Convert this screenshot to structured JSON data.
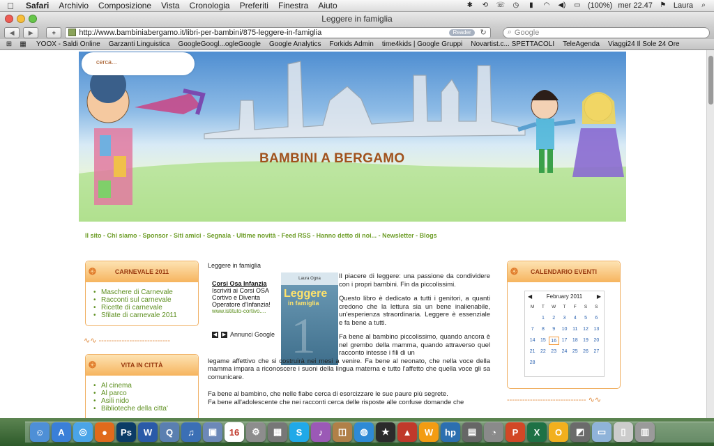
{
  "menubar": {
    "app": "Safari",
    "items": [
      "Archivio",
      "Composizione",
      "Vista",
      "Cronologia",
      "Preferiti",
      "Finestra",
      "Aiuto"
    ],
    "battery": "(100%)",
    "clock": "mer 22.47",
    "user": "Laura"
  },
  "window": {
    "title": "Leggere in famiglia",
    "url": "http://www.bambiniabergamo.it/libri-per-bambini/875-leggere-in-famiglia",
    "reader_label": "Reader",
    "search_placeholder": "Google"
  },
  "bookmarks": [
    "YOOX - Saldi Online",
    "Garzanti Linguistica",
    "GoogleGoogl...ogleGoogle",
    "Google Analytics",
    "Forkids Admin",
    "time4kids | Google Gruppi",
    "Novartist.c... SPETTACOLI",
    "TeleAgenda",
    "Viaggi24 Il Sole 24 Ore"
  ],
  "site": {
    "search_label": "cerca...",
    "title": "BAMBINI A BERGAMO",
    "nav": [
      "Il sito",
      "Chi siamo",
      "Sponsor",
      "Siti amici",
      "Segnala",
      "Ultime novità",
      "Feed RSS",
      "Hanno detto di noi...",
      "Newsletter",
      "Blogs"
    ],
    "nav_sep": " - "
  },
  "sidebar": {
    "carnevale": {
      "title": "CARNEVALE 2011",
      "items": [
        "Maschere di Carnevale",
        "Racconti sul carnevale",
        "Ricette di carnevale",
        "Sfilate di carnevale 2011"
      ]
    },
    "vita": {
      "title": "VITA IN CITTÀ",
      "items": [
        "Al cinema",
        "Al parco",
        "Asili nido",
        "Biblioteche della citta'"
      ]
    }
  },
  "breadcrumb": "Leggere in famiglia",
  "ad": {
    "title": "Corsi Osa Infanzia",
    "body": "Iscriviti ai Corsi OSA Cortivo e Diventa Operatore d'Infanzia!",
    "url": "www.istituto-cortivo....",
    "label": "Annunci Google"
  },
  "book": {
    "author": "Laura Ogna",
    "title": "Leggere",
    "subtitle": "in famiglia",
    "number": "1"
  },
  "article": {
    "p1": "Il piacere di leggere: una passione da condividere con i propri bambini. Fin da piccolissimi.",
    "p2": "Questo libro è dedicato a tutti i genitori, a quanti credono che la lettura sia un bene inalienabile, un'esperienza straordinaria. Leggere è essenziale e fa bene a tutti.",
    "p3a": "Fa bene al bambino piccolissimo, quando ancora è nel grembo della mamma, quando attraverso quel racconto intesse i fili di un",
    "p3b": "legame affettivo che si costruirà nei mesi a venire. Fa bene al neonato, che nella voce della mamma impara a riconoscere i suoni della lingua materna e tutto l'affetto che quella voce gli sa comunicare.",
    "p4": "Fa bene al bambino, che nelle fiabe cerca di esorcizzare le sue paure più segrete.",
    "p5": "Fa bene all'adolescente che nei racconti cerca delle risposte alle confuse domande che"
  },
  "calendar": {
    "title": "CALENDARIO EVENTI",
    "month": "February 2011",
    "weekdays": [
      "M",
      "T",
      "W",
      "T",
      "F",
      "S",
      "S"
    ],
    "today": "16",
    "weeks": [
      [
        "",
        "1",
        "2",
        "3",
        "4",
        "5",
        "6"
      ],
      [
        "7",
        "8",
        "9",
        "10",
        "11",
        "12",
        "13"
      ],
      [
        "14",
        "15",
        "16",
        "17",
        "18",
        "19",
        "20"
      ],
      [
        "21",
        "22",
        "23",
        "24",
        "25",
        "26",
        "27"
      ],
      [
        "28",
        "",
        "",
        "",
        "",
        "",
        ""
      ]
    ]
  },
  "dock": [
    {
      "name": "finder-icon",
      "color": "#4e8fd6",
      "glyph": "☺"
    },
    {
      "name": "app-store-icon",
      "color": "#3a7fd8",
      "glyph": "A"
    },
    {
      "name": "safari-icon",
      "color": "#4aa4e8",
      "glyph": "◎"
    },
    {
      "name": "firefox-icon",
      "color": "#e06a1c",
      "glyph": "●"
    },
    {
      "name": "photoshop-icon",
      "color": "#0b3c66",
      "glyph": "Ps"
    },
    {
      "name": "word-icon",
      "color": "#2a5aa8",
      "glyph": "W"
    },
    {
      "name": "quicktime-icon",
      "color": "#5a7fb0",
      "glyph": "Q"
    },
    {
      "name": "itunes-icon",
      "color": "#3b6fb5",
      "glyph": "♫"
    },
    {
      "name": "preview-icon",
      "color": "#6c88b8",
      "glyph": "▣"
    },
    {
      "name": "ical-icon",
      "color": "#ffffff",
      "glyph": "16"
    },
    {
      "name": "system-preferences-icon",
      "color": "#8d8d8d",
      "glyph": "⚙"
    },
    {
      "name": "calculator-icon",
      "color": "#777777",
      "glyph": "▦"
    },
    {
      "name": "skype-icon",
      "color": "#20a9e8",
      "glyph": "S"
    },
    {
      "name": "music-icon",
      "color": "#9b59b6",
      "glyph": "♪"
    },
    {
      "name": "photo-icon",
      "color": "#b08048",
      "glyph": "◫"
    },
    {
      "name": "network-icon",
      "color": "#2e8ad6",
      "glyph": "◍"
    },
    {
      "name": "star-icon",
      "color": "#2b2b2b",
      "glyph": "★"
    },
    {
      "name": "red-app-icon",
      "color": "#c0392b",
      "glyph": "▲"
    },
    {
      "name": "wind-icon",
      "color": "#f39c12",
      "glyph": "W"
    },
    {
      "name": "hp-icon",
      "color": "#2c6fb0",
      "glyph": "hp"
    },
    {
      "name": "printer-icon",
      "color": "#666666",
      "glyph": "▤"
    },
    {
      "name": "disk-icon",
      "color": "#8a8a8a",
      "glyph": "◔"
    },
    {
      "name": "powerpoint-icon",
      "color": "#d24726",
      "glyph": "P"
    },
    {
      "name": "excel-icon",
      "color": "#1e7145",
      "glyph": "X"
    },
    {
      "name": "outlook-icon",
      "color": "#f2b01e",
      "glyph": "O"
    },
    {
      "name": "photo-stack-icon",
      "color": "#6b6b6b",
      "glyph": "◩"
    },
    {
      "name": "folder-icon",
      "color": "#8fb3d9",
      "glyph": "▭"
    },
    {
      "name": "documents-icon",
      "color": "#cccccc",
      "glyph": "▯"
    },
    {
      "name": "trash-icon",
      "color": "#9a9a9a",
      "glyph": "▥"
    }
  ]
}
